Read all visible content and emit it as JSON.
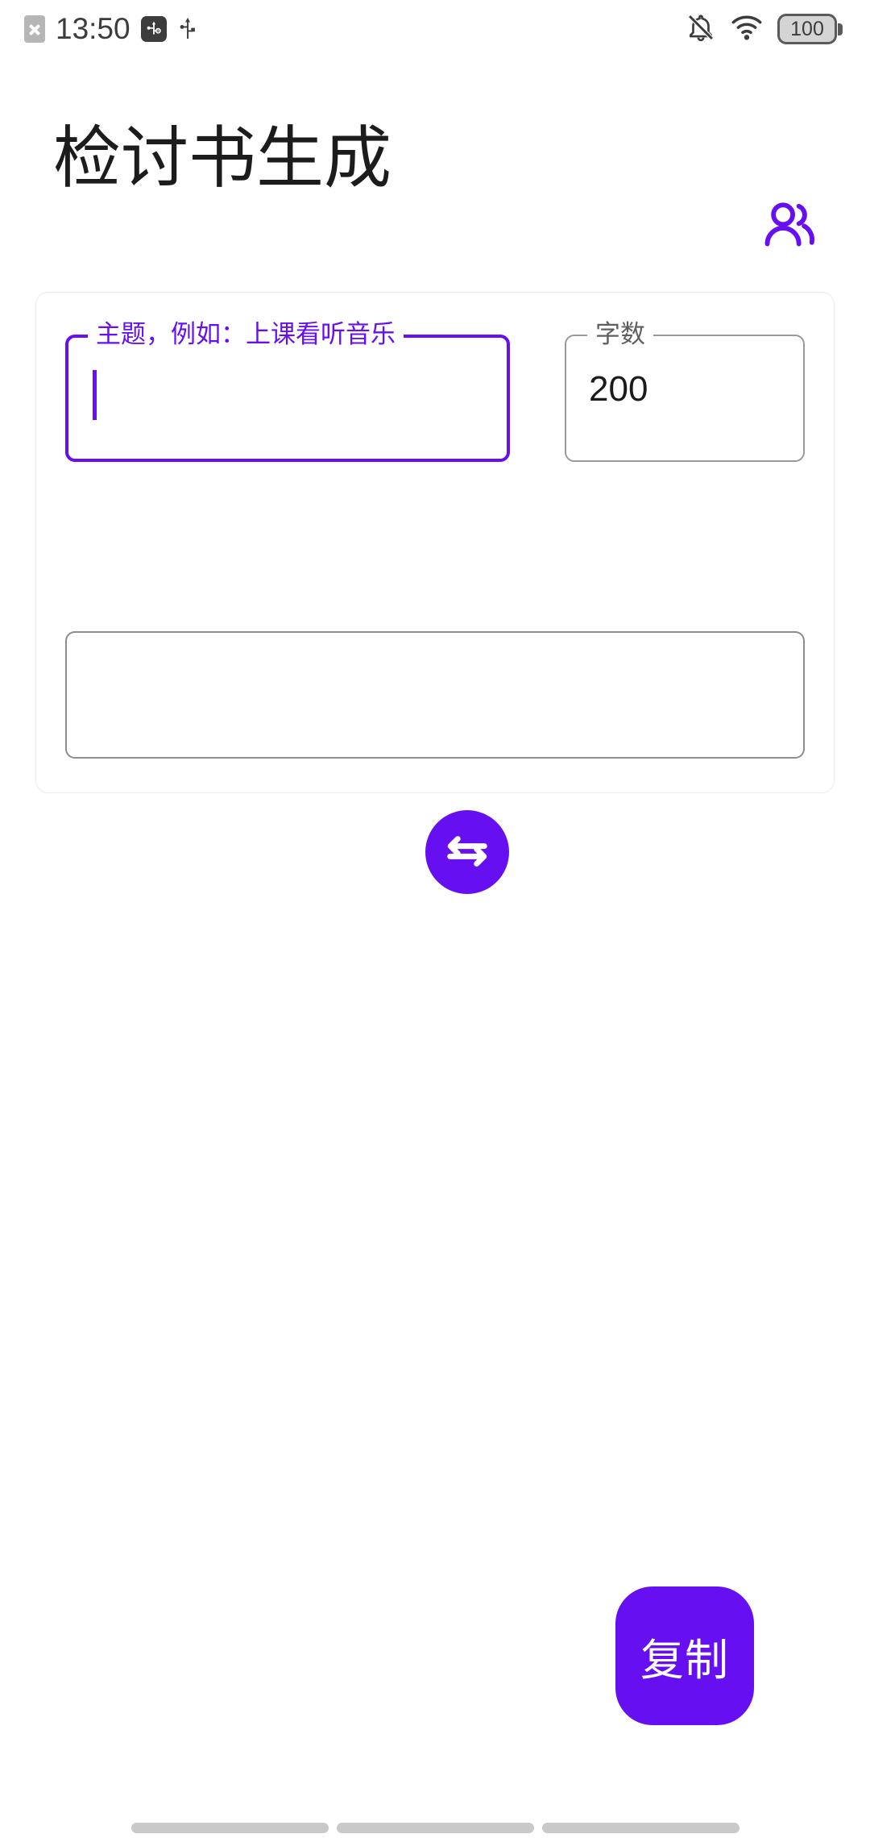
{
  "status_bar": {
    "time": "13:50",
    "battery_level": "100",
    "icons": {
      "sim_no_service": "sim-card-x-icon",
      "usb_debugging": "usb-debugging-icon",
      "usb": "usb-icon",
      "ringer_muted": "bell-off-icon",
      "wifi": "wifi-icon",
      "battery": "battery-icon"
    }
  },
  "app_bar": {
    "title": "检讨书生成",
    "members_icon": "people-icon"
  },
  "form": {
    "topic": {
      "label": "主题，例如：上课看听音乐",
      "value": "",
      "focused": true
    },
    "word_count": {
      "label": "字数",
      "value": "200"
    },
    "generate_button": {
      "icon": "swap-horizontal-arrows-icon"
    },
    "output": {
      "value": ""
    }
  },
  "copy_fab": {
    "label": "复制"
  },
  "nav_bar": {
    "items": [
      "recents-pill",
      "home-pill",
      "back-pill"
    ]
  },
  "colors": {
    "accent": "#6610f2",
    "text_primary": "#1b1b1b",
    "border_gray": "#8d8d8d",
    "card_border": "#ececec",
    "nav_pill": "#c9c9c9"
  }
}
